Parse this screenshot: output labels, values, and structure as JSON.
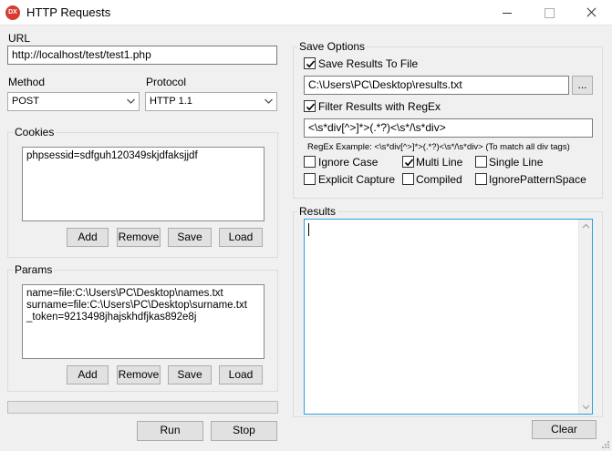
{
  "window": {
    "title": "HTTP Requests",
    "app_icon_text": "DX"
  },
  "url": {
    "label": "URL",
    "value": "http://localhost/test/test1.php"
  },
  "method": {
    "label": "Method",
    "value": "POST"
  },
  "protocol": {
    "label": "Protocol",
    "value": "HTTP 1.1"
  },
  "cookies": {
    "label": "Cookies",
    "content": "phpsessid=sdfguh120349skjdfaksjjdf",
    "buttons": {
      "add": "Add",
      "remove": "Remove",
      "save": "Save",
      "load": "Load"
    }
  },
  "params": {
    "label": "Params",
    "content": "name=file:C:\\Users\\PC\\Desktop\\names.txt\nsurname=file:C:\\Users\\PC\\Desktop\\surname.txt\n_token=9213498jhajskhdfjkas892e8j",
    "buttons": {
      "add": "Add",
      "remove": "Remove",
      "save": "Save",
      "load": "Load"
    }
  },
  "progress": {
    "value": 0
  },
  "actions": {
    "run": "Run",
    "stop": "Stop"
  },
  "save_options": {
    "label": "Save Options",
    "save_to_file": {
      "label": "Save Results To File",
      "checked": true
    },
    "file_path": "C:\\Users\\PC\\Desktop\\results.txt",
    "browse": "...",
    "filter_regex": {
      "label": "Filter Results with RegEx",
      "checked": true
    },
    "regex": "<\\s*div[^>]*>(.*?)<\\s*/\\s*div>",
    "regex_example": "RegEx Example: <\\s*div[^>]*>(.*?)<\\s*/\\s*div> (To match all div tags)",
    "options": [
      {
        "label": "Ignore Case",
        "checked": false
      },
      {
        "label": "Multi Line",
        "checked": true
      },
      {
        "label": "Single Line",
        "checked": false
      },
      {
        "label": "Explicit Capture",
        "checked": false
      },
      {
        "label": "Compiled",
        "checked": false
      },
      {
        "label": "IgnorePatternSpace",
        "checked": false
      }
    ]
  },
  "results": {
    "label": "Results",
    "content": "",
    "clear": "Clear"
  }
}
